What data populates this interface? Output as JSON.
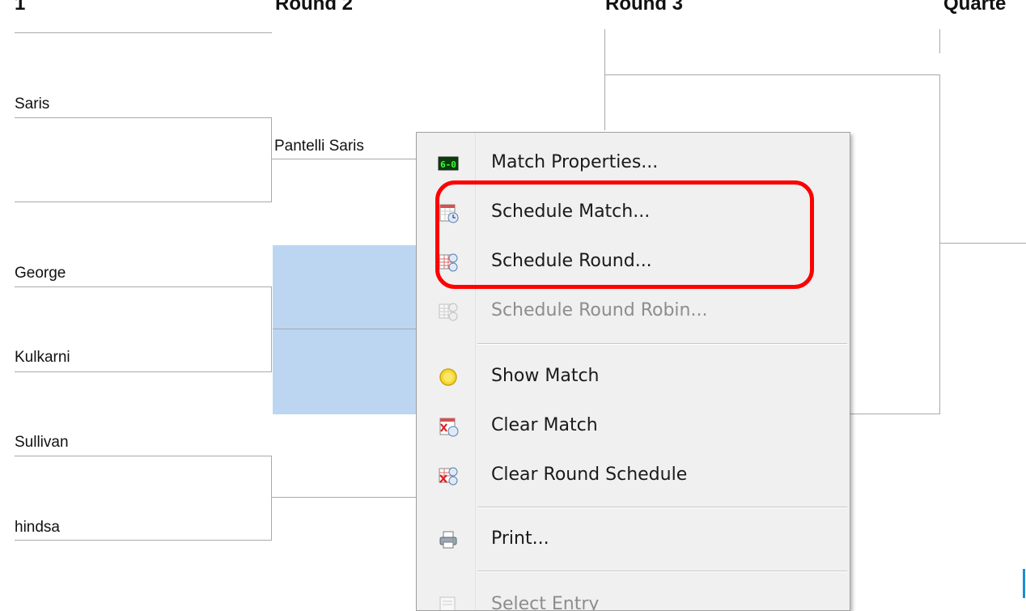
{
  "bracket": {
    "headers": {
      "round1": "1",
      "round2": "Round 2",
      "round3": "Round 3",
      "quarterfinal": "Quarte"
    },
    "players_round1": [
      {
        "name": "Saris"
      },
      {
        "name": "George"
      },
      {
        "name": "Kulkarni"
      },
      {
        "name": "Sullivan"
      },
      {
        "name": "hindsa"
      }
    ],
    "players_round2": [
      {
        "name": "Pantelli Saris"
      }
    ]
  },
  "context_menu": {
    "items": [
      {
        "label": "Match Properties...",
        "icon": "match-score-icon",
        "enabled": true
      },
      {
        "label": "Schedule Match...",
        "icon": "calendar-clock-icon",
        "enabled": true
      },
      {
        "label": "Schedule Round...",
        "icon": "grid-clock-icon",
        "enabled": true
      },
      {
        "label": "Schedule Round Robin...",
        "icon": "grid-clock-icon",
        "enabled": false
      },
      {
        "label": "Show Match",
        "icon": "yellow-circle-icon",
        "enabled": true
      },
      {
        "label": "Clear Match",
        "icon": "calendar-x-icon",
        "enabled": true
      },
      {
        "label": "Clear Round Schedule",
        "icon": "grid-x-icon",
        "enabled": true
      },
      {
        "label": "Print...",
        "icon": "printer-icon",
        "enabled": true
      },
      {
        "label": "Select Entry",
        "icon": "entry-icon",
        "enabled": false
      }
    ]
  },
  "colors": {
    "selection": "#bcd6f1",
    "annotation": "#ff0000",
    "bracket_line": "#a9a9a9"
  }
}
